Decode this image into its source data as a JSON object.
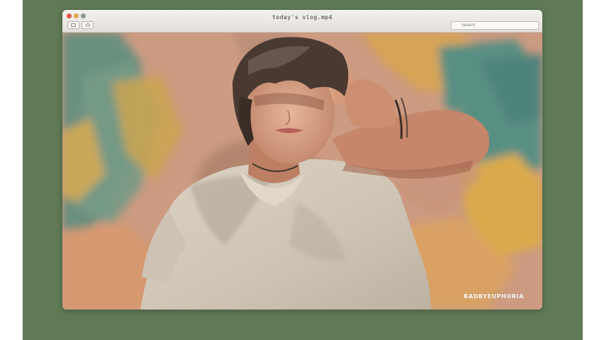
{
  "window": {
    "title": "today's vlog.mp4"
  },
  "toolbar": {
    "search_placeholder": "Search"
  },
  "video": {
    "watermark": "BADBYEUPHORIA"
  },
  "colors": {
    "backdrop": "#5f7a55",
    "close": "#e2564d",
    "minimize": "#e0a94a",
    "maximize": "#8a9a8a"
  }
}
